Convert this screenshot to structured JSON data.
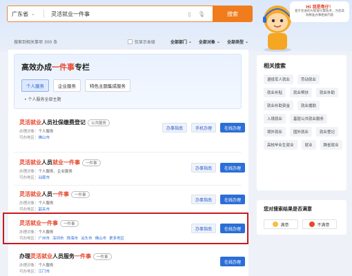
{
  "search": {
    "region": "广东省",
    "query": "灵活就业一件事",
    "button": "搜索"
  },
  "mascot": {
    "greeting": "Hi 我是粤仔！",
    "tip": "基于先进的AI智能引擎技术，为您高效精准办事相关内容"
  },
  "filters": {
    "count": "搜索到相关事项 300 条",
    "only_local": "仅显示本级",
    "dept": "全部部门",
    "target": "全部对象",
    "type": "全部类型"
  },
  "special": {
    "title_pre": "高效办成",
    "title_hl": "一件事",
    "title_post": "专栏",
    "tabs": [
      "个人服务",
      "企业服务",
      "特色主题集成服务"
    ],
    "sub": "个人服务全部主题"
  },
  "items": [
    {
      "title_hl": "灵活就业",
      "title_post": "人员社保缴费登记",
      "badge": "公共服务",
      "target_label": "办理对象：",
      "target": "个人服务",
      "area_label": "可办地区：",
      "areas": [
        "佛山市"
      ],
      "buttons": [
        "办事指南",
        "手机办理",
        "在线办理"
      ]
    },
    {
      "title_hl": "灵活就业",
      "title_mid": "人员",
      "title_hl2": "就业一件事",
      "badge": "一件事",
      "target_label": "办理对象：",
      "target": "个人服务、企业服务",
      "area_label": "可办地区：",
      "areas": [
        "汕尾市"
      ],
      "buttons": [
        "办事指南",
        "在线办理"
      ]
    },
    {
      "title_hl": "灵活就业",
      "title_mid": "人员",
      "title_hl2": "一件事",
      "badge": "一件事",
      "target_label": "办理对象：",
      "target": "个人服务",
      "area_label": "可办地区：",
      "areas": [
        "韶关市"
      ],
      "buttons": [
        "办事指南",
        "在线办理"
      ]
    },
    {
      "title_hl": "灵活就业一件事",
      "badge": "一件事",
      "target_label": "办理对象：",
      "target": "个人服务",
      "area_label": "可办地区：",
      "areas": [
        "广州市",
        "深圳市",
        "珠海市",
        "汕头市",
        "佛山市",
        "更多地区"
      ],
      "buttons": [
        "办事指南",
        "在线办理"
      ]
    },
    {
      "title_pre": "办理",
      "title_hl": "灵活就业",
      "title_mid": "人员服务",
      "title_hl2": "一件事",
      "badge": "一件事",
      "target_label": "办理对象：",
      "target": "个人服务",
      "area_label": "可办地区：",
      "areas": [
        "江门市"
      ],
      "buttons": [
        "在线办理"
      ]
    }
  ],
  "related": {
    "title": "相关搜索",
    "tags": [
      "退役军人就业",
      "劳动就业",
      "就业补贴",
      "就业帮扶",
      "就业补助",
      "就业补助资金",
      "就业援助",
      "入境就业",
      "基层公共就业服务",
      "境外就业",
      "国外就业",
      "就业登记",
      "高校毕业生就业",
      "就业",
      "跨省就业"
    ]
  },
  "survey": {
    "title": "您对搜索结果是否满意",
    "yes": "满意",
    "no": "不满意"
  },
  "colors": {
    "accent": "#f07c1e",
    "primary": "#2b6ed6",
    "highlight_text": "#e8452a",
    "frame": "#c8181e"
  }
}
